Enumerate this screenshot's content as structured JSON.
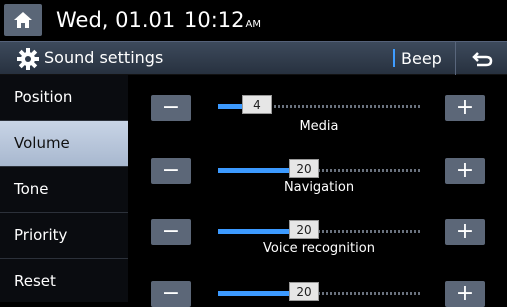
{
  "status": {
    "date": "Wed, 01.01",
    "time": "10:12",
    "ampm": "AM"
  },
  "header": {
    "title": "Sound settings",
    "beep_label": "Beep"
  },
  "sidebar": {
    "items": [
      {
        "label": "Position"
      },
      {
        "label": "Volume"
      },
      {
        "label": "Tone"
      },
      {
        "label": "Priority"
      },
      {
        "label": "Reset"
      }
    ]
  },
  "sliders": [
    {
      "label": "Media",
      "value": "4",
      "fraction": 0.17
    },
    {
      "label": "Navigation",
      "value": "20",
      "fraction": 0.4
    },
    {
      "label": "Voice recognition",
      "value": "20",
      "fraction": 0.4
    },
    {
      "label": "",
      "value": "20",
      "fraction": 0.4
    }
  ],
  "controls": {
    "minus": "−",
    "plus": "+"
  },
  "colors": {
    "accent": "#3c9aff",
    "active_tab": "#b8c6da",
    "button": "#5c6778"
  }
}
